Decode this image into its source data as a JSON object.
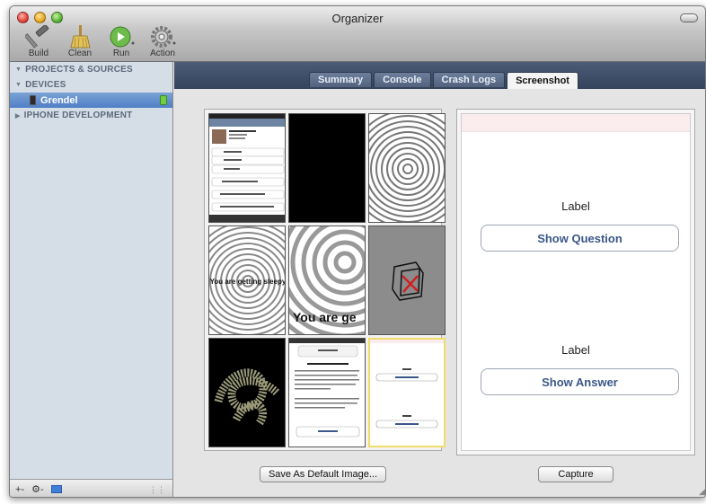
{
  "window": {
    "title": "Organizer"
  },
  "toolbar": {
    "items": [
      {
        "label": "Build",
        "icon": "hammer-icon"
      },
      {
        "label": "Clean",
        "icon": "broom-icon"
      },
      {
        "label": "Run",
        "icon": "run-icon"
      },
      {
        "label": "Action",
        "icon": "gear-icon"
      }
    ]
  },
  "sidebar": {
    "groups": [
      {
        "label": "PROJECTS & SOURCES"
      },
      {
        "label": "DEVICES"
      }
    ],
    "device": {
      "label": "Grendel"
    },
    "iphone_dev": {
      "label": "IPHONE DEVELOPMENT"
    },
    "bottom": {
      "add": "+-",
      "gear": "⚙-"
    }
  },
  "tabs": [
    {
      "label": "Summary"
    },
    {
      "label": "Console"
    },
    {
      "label": "Crash Logs"
    },
    {
      "label": "Screenshot",
      "active": true
    }
  ],
  "gallery": {
    "thumb5_text": "You are ge",
    "thumb4_text": "You are getting sleepy"
  },
  "phone": {
    "label1": "Label",
    "button1": "Show Question",
    "label2": "Label",
    "button2": "Show Answer"
  },
  "buttons": {
    "save_default": "Save As Default Image...",
    "capture": "Capture"
  },
  "colors": {
    "tabbar": "#3f4e68",
    "sidebar": "#d5dde7",
    "selection": "#5b88c8",
    "button_text": "#3a5788"
  }
}
